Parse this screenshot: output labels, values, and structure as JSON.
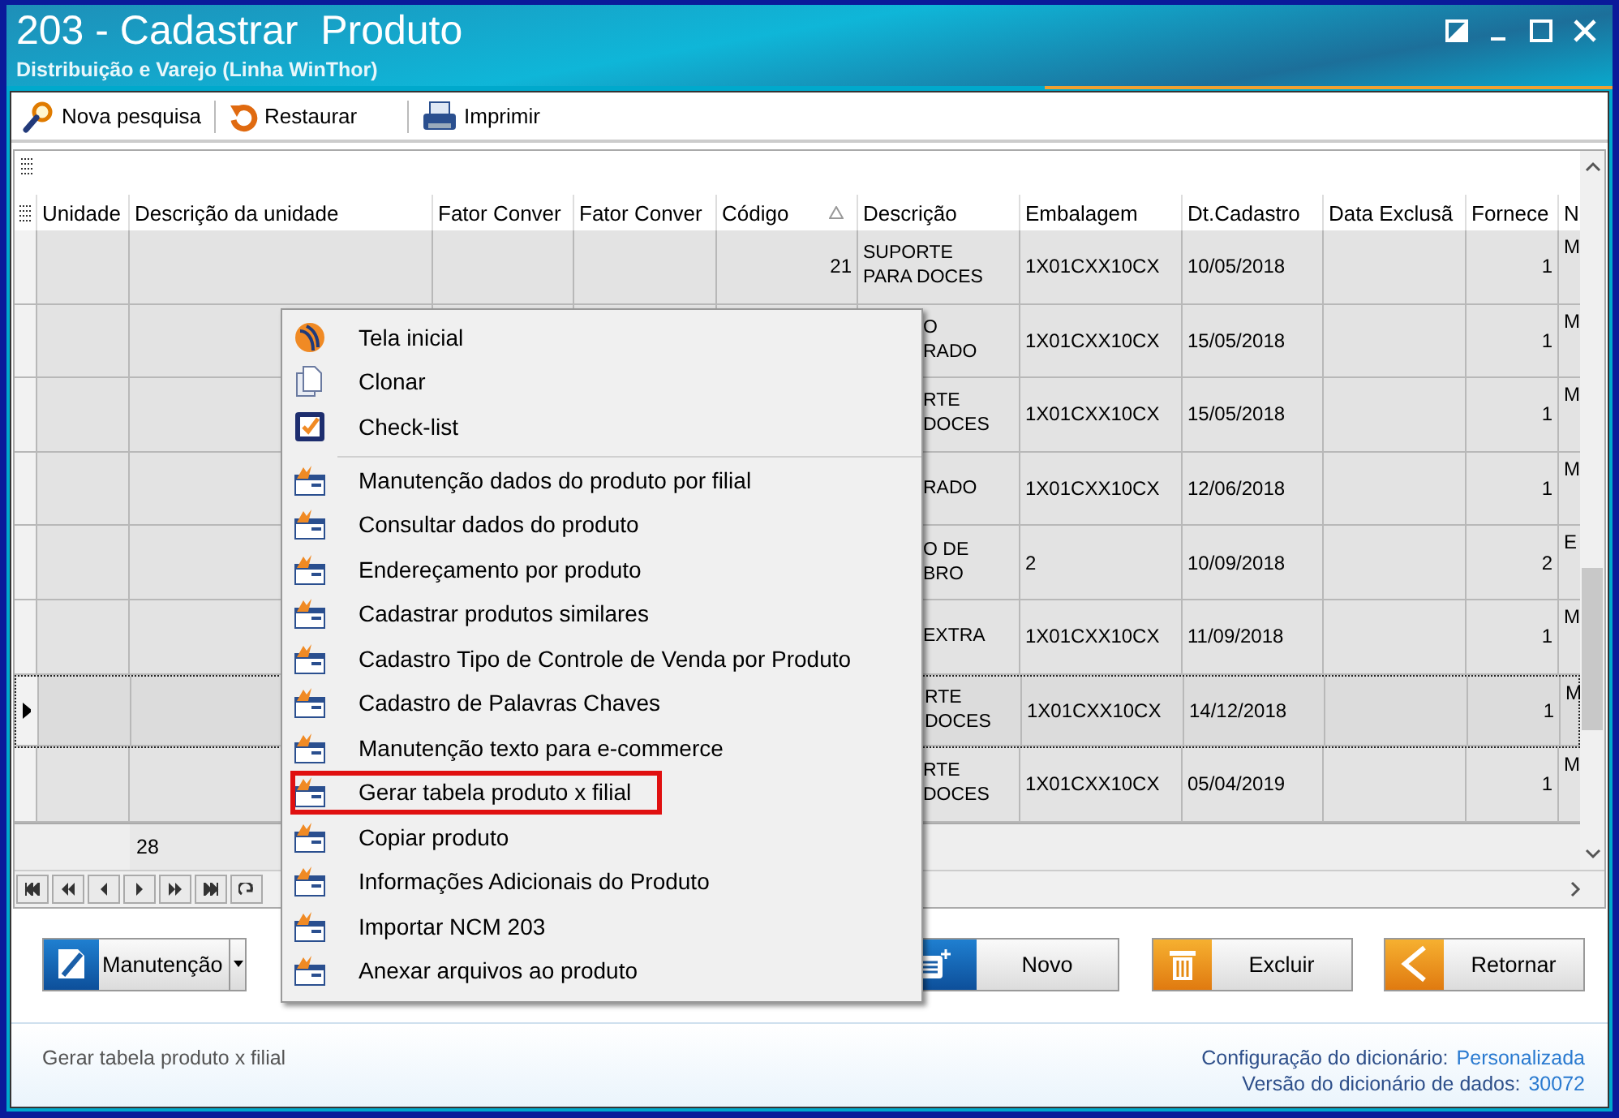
{
  "window": {
    "title": "203 - Cadastrar  Produto",
    "subtitle": "Distribuição e Varejo (Linha WinThor)"
  },
  "toolbar": [
    {
      "label": "Nova pesquisa",
      "kind": "search"
    },
    {
      "label": "Restaurar",
      "kind": "restore"
    },
    {
      "label": "Imprimir",
      "kind": "print"
    }
  ],
  "grid": {
    "columns": [
      {
        "label": "Unidade",
        "sorted": false
      },
      {
        "label": "Descrição da unidade",
        "sorted": false
      },
      {
        "label": "Fator Conver",
        "sorted": false
      },
      {
        "label": "Fator Conver",
        "sorted": false
      },
      {
        "label": "Código",
        "sorted": true
      },
      {
        "label": "Descrição",
        "sorted": false
      },
      {
        "label": "Embalagem",
        "sorted": false
      },
      {
        "label": "Dt.Cadastro",
        "sorted": false
      },
      {
        "label": "Data Exclusã",
        "sorted": false
      },
      {
        "label": "Fornece",
        "sorted": false
      },
      {
        "label": "N",
        "sorted": false
      }
    ],
    "rows": [
      {
        "selected": false,
        "codigo": "21",
        "descricao": [
          "SUPORTE",
          "PARA DOCES"
        ],
        "descricao_clipped": false,
        "embalagem": "1X01CXX10CX",
        "dt_cadastro": "10/05/2018",
        "fornecedor": "1",
        "column_11": "M"
      },
      {
        "selected": false,
        "descricao": [
          "O",
          "RADO"
        ],
        "descricao_clipped": true,
        "embalagem": "1X01CXX10CX",
        "dt_cadastro": "15/05/2018",
        "fornecedor": "1",
        "column_11": "M"
      },
      {
        "selected": false,
        "descricao": [
          "RTE",
          "DOCES"
        ],
        "descricao_clipped": true,
        "embalagem": "1X01CXX10CX",
        "dt_cadastro": "15/05/2018",
        "fornecedor": "1",
        "column_11": "M"
      },
      {
        "selected": false,
        "descricao": [
          "RADO"
        ],
        "descricao_clipped": true,
        "embalagem": "1X01CXX10CX",
        "dt_cadastro": "12/06/2018",
        "fornecedor": "1",
        "column_11": "M"
      },
      {
        "selected": false,
        "descricao": [
          "O DE",
          "BRO"
        ],
        "descricao_clipped": true,
        "embalagem": "2",
        "dt_cadastro": "10/09/2018",
        "fornecedor": "2",
        "column_11": "E"
      },
      {
        "selected": false,
        "descricao": [
          "EXTRA"
        ],
        "descricao_clipped": true,
        "embalagem": "1X01CXX10CX",
        "dt_cadastro": "11/09/2018",
        "fornecedor": "1",
        "column_11": "M"
      },
      {
        "selected": true,
        "descricao": [
          "RTE",
          "DOCES"
        ],
        "descricao_clipped": true,
        "embalagem": "1X01CXX10CX",
        "dt_cadastro": "14/12/2018",
        "fornecedor": "1",
        "column_11": "M"
      },
      {
        "selected": false,
        "descricao": [
          "RTE",
          "DOCES"
        ],
        "descricao_clipped": true,
        "embalagem": "1X01CXX10CX",
        "dt_cadastro": "05/04/2019",
        "fornecedor": "1",
        "column_11": "M"
      }
    ],
    "footer_count": "28"
  },
  "context_menu": {
    "items": [
      {
        "label": "Tela inicial",
        "kind": "home",
        "highlighted": false,
        "separator_after": false
      },
      {
        "label": "Clonar",
        "kind": "clone",
        "highlighted": false,
        "separator_after": false
      },
      {
        "label": "Check-list",
        "kind": "checklist",
        "highlighted": false,
        "separator_after": true
      },
      {
        "label": "Manutenção dados do produto por filial",
        "kind": "form",
        "highlighted": false,
        "separator_after": false
      },
      {
        "label": "Consultar dados do produto",
        "kind": "form",
        "highlighted": false,
        "separator_after": false
      },
      {
        "label": "Endereçamento por produto",
        "kind": "form",
        "highlighted": false,
        "separator_after": false
      },
      {
        "label": "Cadastrar produtos similares",
        "kind": "form",
        "highlighted": false,
        "separator_after": false
      },
      {
        "label": "Cadastro Tipo de Controle de Venda por Produto",
        "kind": "form",
        "highlighted": false,
        "separator_after": false
      },
      {
        "label": "Cadastro de Palavras Chaves",
        "kind": "form",
        "highlighted": false,
        "separator_after": false
      },
      {
        "label": "Manutenção texto para e-commerce",
        "kind": "form",
        "highlighted": false,
        "separator_after": false
      },
      {
        "label": "Gerar tabela produto x filial",
        "kind": "form",
        "highlighted": true,
        "separator_after": false
      },
      {
        "label": "Copiar produto",
        "kind": "form",
        "highlighted": false,
        "separator_after": false
      },
      {
        "label": "Informações Adicionais do Produto",
        "kind": "form",
        "highlighted": false,
        "separator_after": false
      },
      {
        "label": "Importar NCM 203",
        "kind": "form",
        "highlighted": false,
        "separator_after": false
      },
      {
        "label": "Anexar arquivos ao produto",
        "kind": "form",
        "highlighted": false,
        "separator_after": false
      }
    ]
  },
  "buttons": [
    {
      "label": "Manutenção",
      "kind": "maintenance"
    },
    {
      "label": "Novo",
      "kind": "new"
    },
    {
      "label": "Excluir",
      "kind": "delete"
    },
    {
      "label": "Retornar",
      "kind": "back"
    }
  ],
  "status_bar": {
    "message": "Gerar tabela produto x filial",
    "info": [
      {
        "label": "Configuração do dicionário:",
        "value": "Personalizada"
      },
      {
        "label": "Versão do dicionário de dados:",
        "value": "30072"
      }
    ]
  }
}
